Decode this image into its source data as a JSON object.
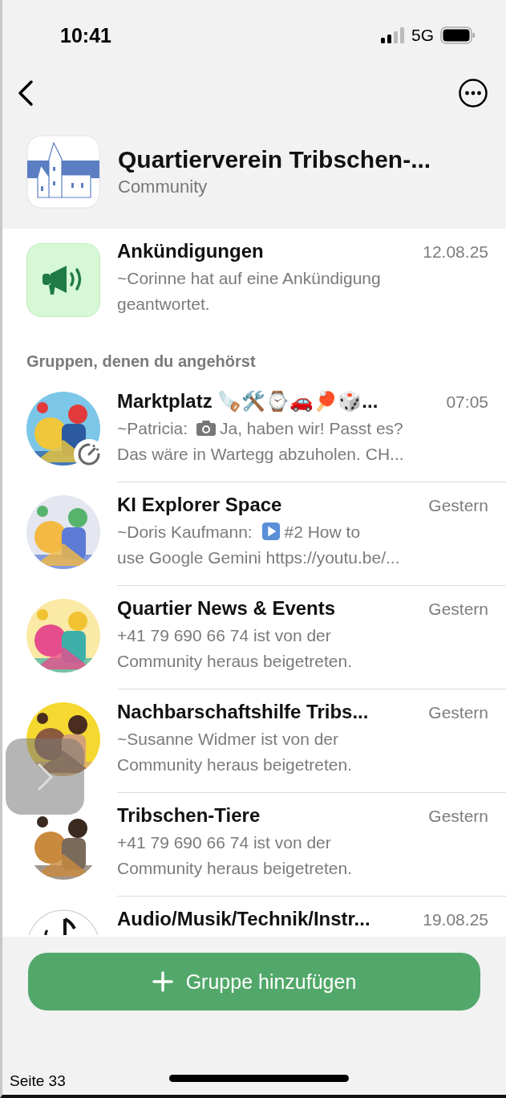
{
  "status_bar": {
    "time": "10:41",
    "network": "5G"
  },
  "community": {
    "name": "Quartierverein Tribschen-...",
    "subtitle": "Community"
  },
  "announcements": {
    "title": "Ankündigungen",
    "date": "12.08.25",
    "preview": [
      "~Corinne hat auf eine Ankündigung",
      "geantwortet."
    ]
  },
  "section_title": "Gruppen, denen du angehörst",
  "groups": [
    {
      "name": "Marktplatz 🪚🛠️⌚🚗🏓🎲...",
      "time": "07:05",
      "sender": "~Patricia:",
      "attachment": {
        "kind": "camera"
      },
      "preview": [
        "Ja, haben wir! Passt es?",
        "Das wäre in Wartegg abzuholen. CH..."
      ],
      "timer": true
    },
    {
      "name": "KI Explorer Space",
      "time": "Gestern",
      "sender": "~Doris Kaufmann:",
      "attachment": {
        "kind": "play"
      },
      "preview": [
        "#2 How to",
        "use Google Gemini https://youtu.be/..."
      ],
      "timer": false
    },
    {
      "name": "Quartier News & Events",
      "time": "Gestern",
      "preview": [
        "+41 79 690 66 74 ist von der",
        "Community heraus beigetreten."
      ],
      "timer": false
    },
    {
      "name": "Nachbarschaftshilfe Tribs...",
      "time": "Gestern",
      "preview": [
        "~Susanne Widmer ist von der",
        "Community heraus beigetreten."
      ],
      "timer": false
    },
    {
      "name": "Tribschen-Tiere",
      "time": "Gestern",
      "preview": [
        "+41 79 690 66 74 ist von der",
        "Community heraus beigetreten."
      ],
      "timer": false
    },
    {
      "name": "Audio/Musik/Technik/Instr...",
      "time": "19.08.25",
      "timer": false
    }
  ],
  "add_button": {
    "label": "Gruppe hinzufügen"
  },
  "page_footer": "Seite 33"
}
